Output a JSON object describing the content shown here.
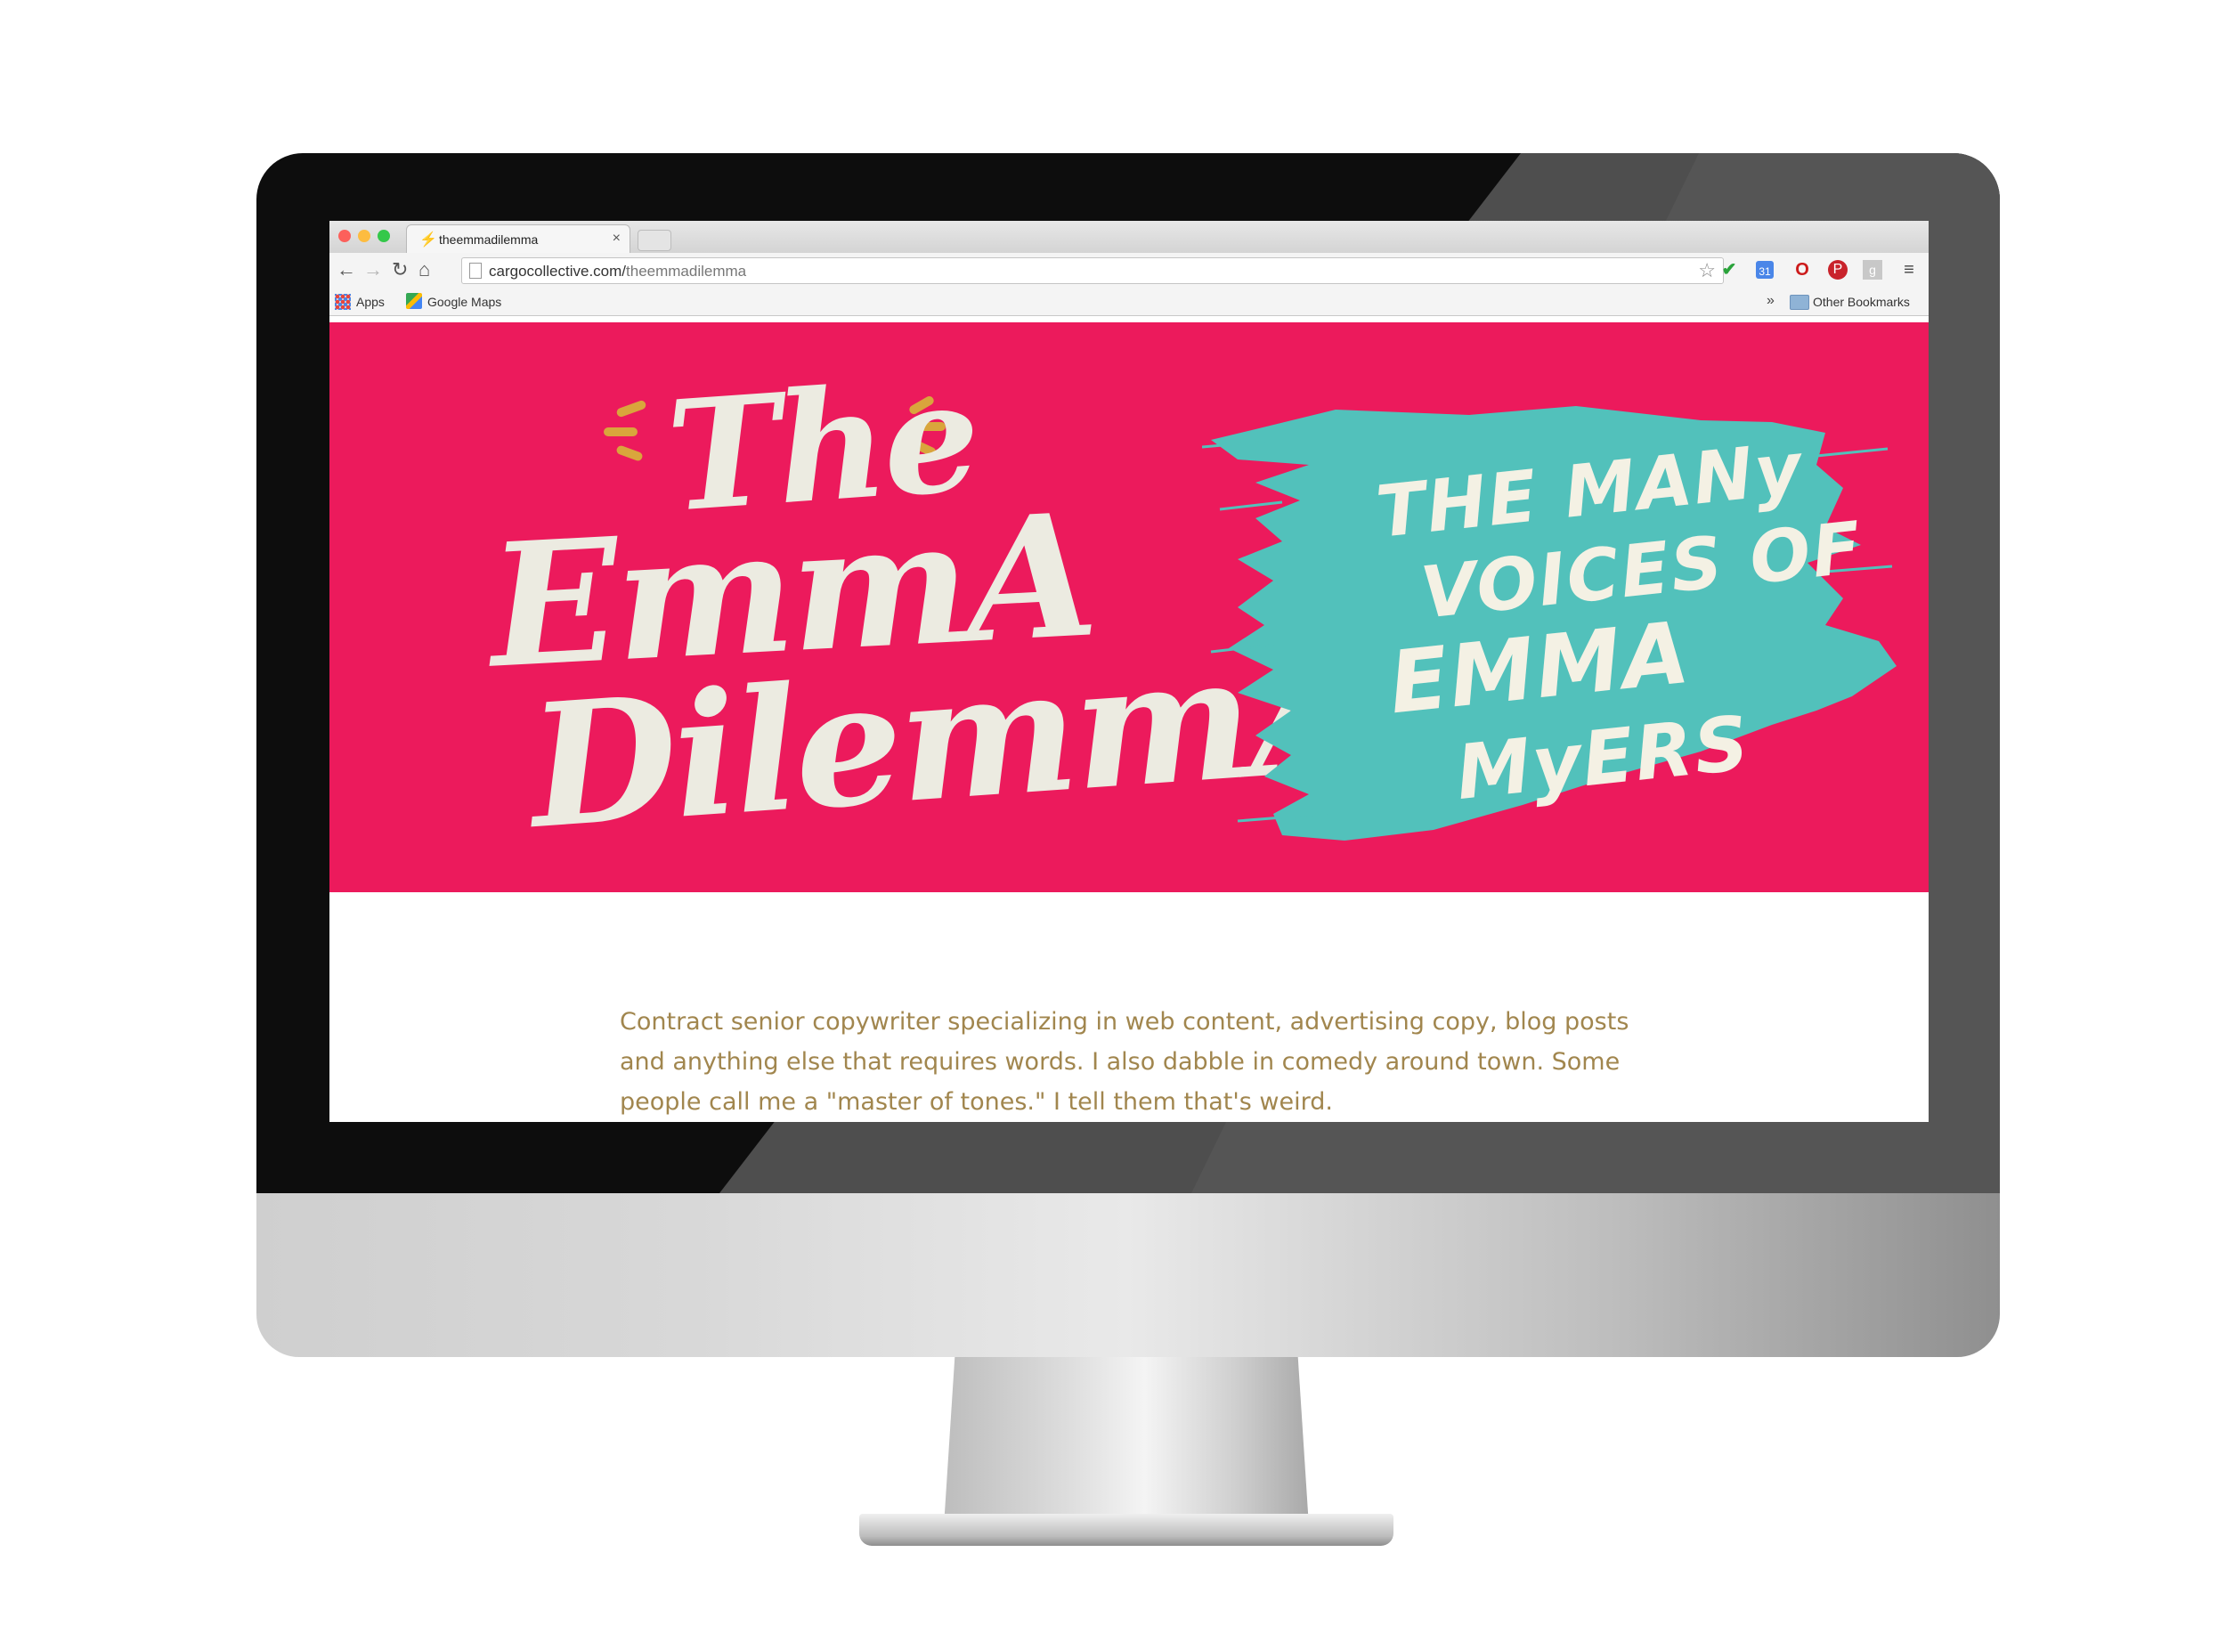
{
  "browser": {
    "tab_title": "theemmadilemma",
    "tab_icon": "⚡",
    "tab_close": "×",
    "url_host": "cargocollective.com/",
    "url_path": "theemmadilemma",
    "bookmarks": {
      "apps": "Apps",
      "google_maps": "Google Maps",
      "overflow": "»",
      "other": "Other Bookmarks"
    },
    "nav": {
      "back": "←",
      "forward": "→",
      "reload": "↻",
      "home": "⌂"
    },
    "star": "☆",
    "extensions": {
      "check": "✔",
      "menu": "≡",
      "opera": "O",
      "pinterest": "P",
      "gplus": "g",
      "calendar": "31"
    }
  },
  "hero": {
    "logo_lines": [
      "The",
      "EmmA",
      "DilemmA"
    ],
    "tagline_lines": [
      "THE MANy",
      "VOICES OF",
      "EMMA",
      "MyERS"
    ],
    "colors": {
      "background": "#ec1a5c",
      "brush": "#52c1bb",
      "lettering": "#ecebe1",
      "accent": "#d9a53c"
    }
  },
  "bio": "Contract senior copywriter specializing in web content, advertising copy, blog posts and anything else that requires words. I also dabble in comedy around town. Some people call me a \"master of tones.\" I tell them that's weird.",
  "text_color": "#a1864e"
}
